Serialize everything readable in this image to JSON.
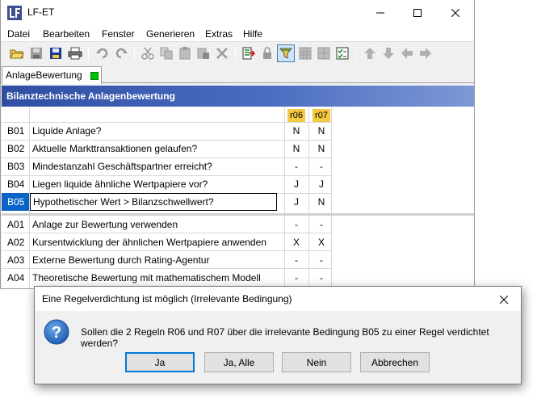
{
  "window": {
    "title": "LF-ET"
  },
  "menu": [
    "Datei",
    "Bearbeiten",
    "Fenster",
    "Generieren",
    "Extras",
    "Hilfe"
  ],
  "toolbar": {
    "icons": [
      "open-folder-icon",
      "save-icon",
      "save-as-icon",
      "print-icon",
      "undo-icon",
      "redo-icon",
      "cut-icon",
      "copy-icon",
      "paste-icon",
      "paste-special-icon",
      "delete-icon",
      "export-icon",
      "lock-icon",
      "funnel-icon",
      "table-icon",
      "grid-icon",
      "checklist-icon",
      "arrow-up-icon",
      "arrow-down-icon",
      "arrow-left-icon",
      "arrow-right-icon"
    ]
  },
  "tab": {
    "label": "AnlageBewertung",
    "status_color": "#00c000"
  },
  "section": {
    "title": "Bilanztechnische Anlagenbewertung"
  },
  "rules": [
    "r06",
    "r07"
  ],
  "conditions": [
    {
      "id": "B01",
      "text": "Liquide Anlage?",
      "values": [
        "N",
        "N"
      ]
    },
    {
      "id": "B02",
      "text": "Aktuelle Markttransaktionen gelaufen?",
      "values": [
        "N",
        "N"
      ]
    },
    {
      "id": "B03",
      "text": "Mindestanzahl Geschäftspartner erreicht?",
      "values": [
        "-",
        "-"
      ]
    },
    {
      "id": "B04",
      "text": "Liegen liquide ähnliche Wertpapiere vor?",
      "values": [
        "J",
        "J"
      ]
    },
    {
      "id": "B05",
      "text": "Hypothetischer Wert > Bilanzschwellwert?",
      "values": [
        "J",
        "N"
      ]
    }
  ],
  "actions": [
    {
      "id": "A01",
      "text": "Anlage zur Bewertung verwenden",
      "values": [
        "-",
        "-"
      ]
    },
    {
      "id": "A02",
      "text": "Kursentwicklung der ähnlichen Wertpapiere anwenden",
      "values": [
        "X",
        "X"
      ]
    },
    {
      "id": "A03",
      "text": "Externe Bewertung durch Rating-Agentur",
      "values": [
        "-",
        "-"
      ]
    },
    {
      "id": "A04",
      "text": "Theoretische Bewertung mit mathematischem Modell",
      "values": [
        "-",
        "-"
      ]
    }
  ],
  "dialog": {
    "title": "Eine Regelverdichtung ist möglich (Irrelevante Bedingung)",
    "message": "Sollen die 2 Regeln R06 und R07 über die irrelevante Bedingung B05 zu einer Regel verdichtet werden?",
    "buttons": {
      "yes": "Ja",
      "yes_all": "Ja, Alle",
      "no": "Nein",
      "cancel": "Abbrechen"
    }
  },
  "colors": {
    "header_blue": "#2e4ea3",
    "rule_header": "#f5c842",
    "selection": "#0a64c8",
    "status_green": "#00c000"
  }
}
